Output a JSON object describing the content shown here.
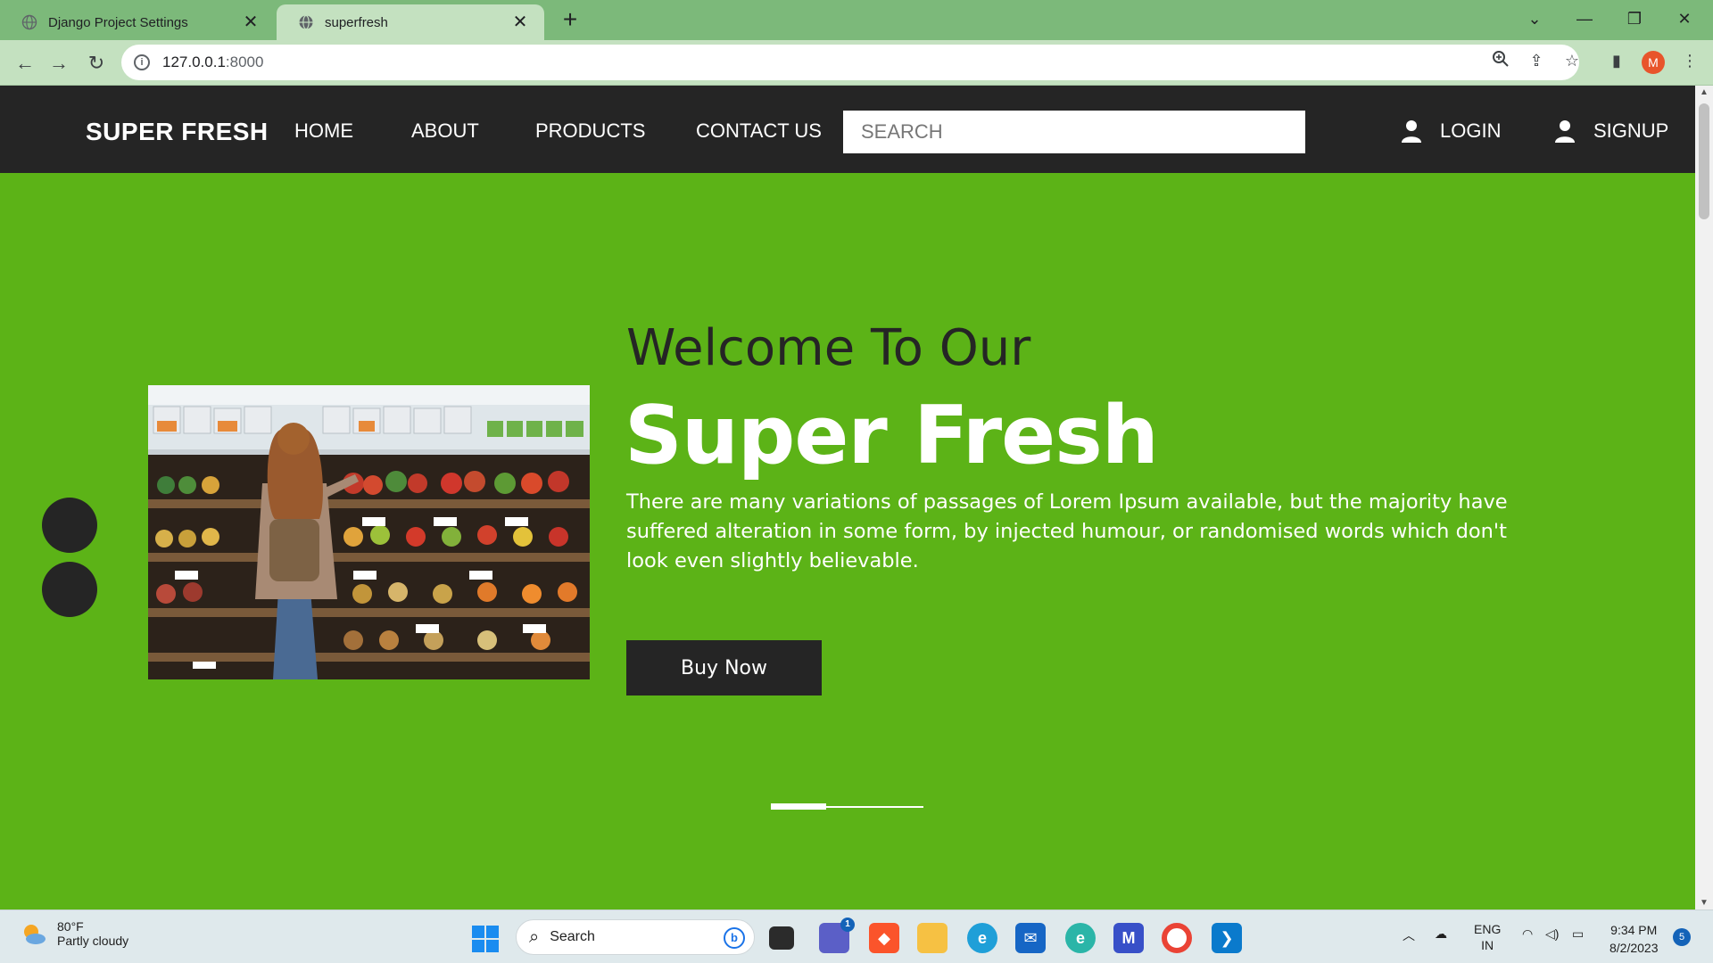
{
  "browser": {
    "tabs": [
      {
        "title": "Django Project Settings",
        "active": false
      },
      {
        "title": "superfresh",
        "active": true
      }
    ],
    "url_host": "127.0.0.1",
    "url_port": ":8000",
    "profile_initial": "M"
  },
  "site": {
    "brand": "SUPER FRESH",
    "nav": [
      "HOME",
      "ABOUT",
      "PRODUCTS",
      "CONTACT US"
    ],
    "search_placeholder": "SEARCH",
    "login_label": "LOGIN",
    "signup_label": "SIGNUP"
  },
  "hero": {
    "welcome": "Welcome To Our",
    "headline": "Super Fresh",
    "description": "There are many variations of passages of Lorem Ipsum available, but the majority have suffered alteration in some form, by injected humour, or randomised words which don't look even slightly believable.",
    "cta": "Buy Now",
    "slide_progress": 0.36
  },
  "colors": {
    "hero_green": "#5cb317",
    "header_dark": "#252525",
    "chrome_frame": "#7cb97a"
  },
  "taskbar": {
    "weather_temp": "80°F",
    "weather_desc": "Partly cloudy",
    "search_label": "Search",
    "teams_badge": "1",
    "lang_line1": "ENG",
    "lang_line2": "IN",
    "time": "9:34 PM",
    "date": "8/2/2023",
    "notification_count": "5"
  }
}
